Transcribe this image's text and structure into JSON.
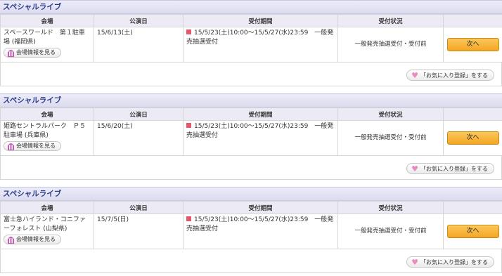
{
  "headers": {
    "venue": "会場",
    "date": "公演日",
    "period": "受付期間",
    "status": "受付状況"
  },
  "venue_info_label": "会場情報を見る",
  "favorite_label": "「お気に入り登録」をする",
  "next_label": "次へ",
  "events": [
    {
      "section_title": "スペシャルライブ",
      "venue": "スペースワールド　第１駐車場 (福岡県)",
      "date": "15/6/13(土)",
      "period": "15/5/23(土)10:00〜15/5/27(水)23:59　一般発売抽選受付",
      "status": "一般発売抽選受付・受付前"
    },
    {
      "section_title": "スペシャルライブ",
      "venue": "姫路セントラルパーク　Ｐ５駐車場 (兵庫県)",
      "date": "15/6/20(土)",
      "period": "15/5/23(土)10:00〜15/5/27(水)23:59　一般発売抽選受付",
      "status": "一般発売抽選受付・受付前"
    },
    {
      "section_title": "スペシャルライブ",
      "venue": "富士急ハイランド・コニファーフォレスト (山梨県)",
      "date": "15/7/5(日)",
      "period": "15/5/23(土)10:00〜15/5/27(水)23:59　一般発売抽選受付",
      "status": "一般発売抽選受付・受付前"
    }
  ]
}
